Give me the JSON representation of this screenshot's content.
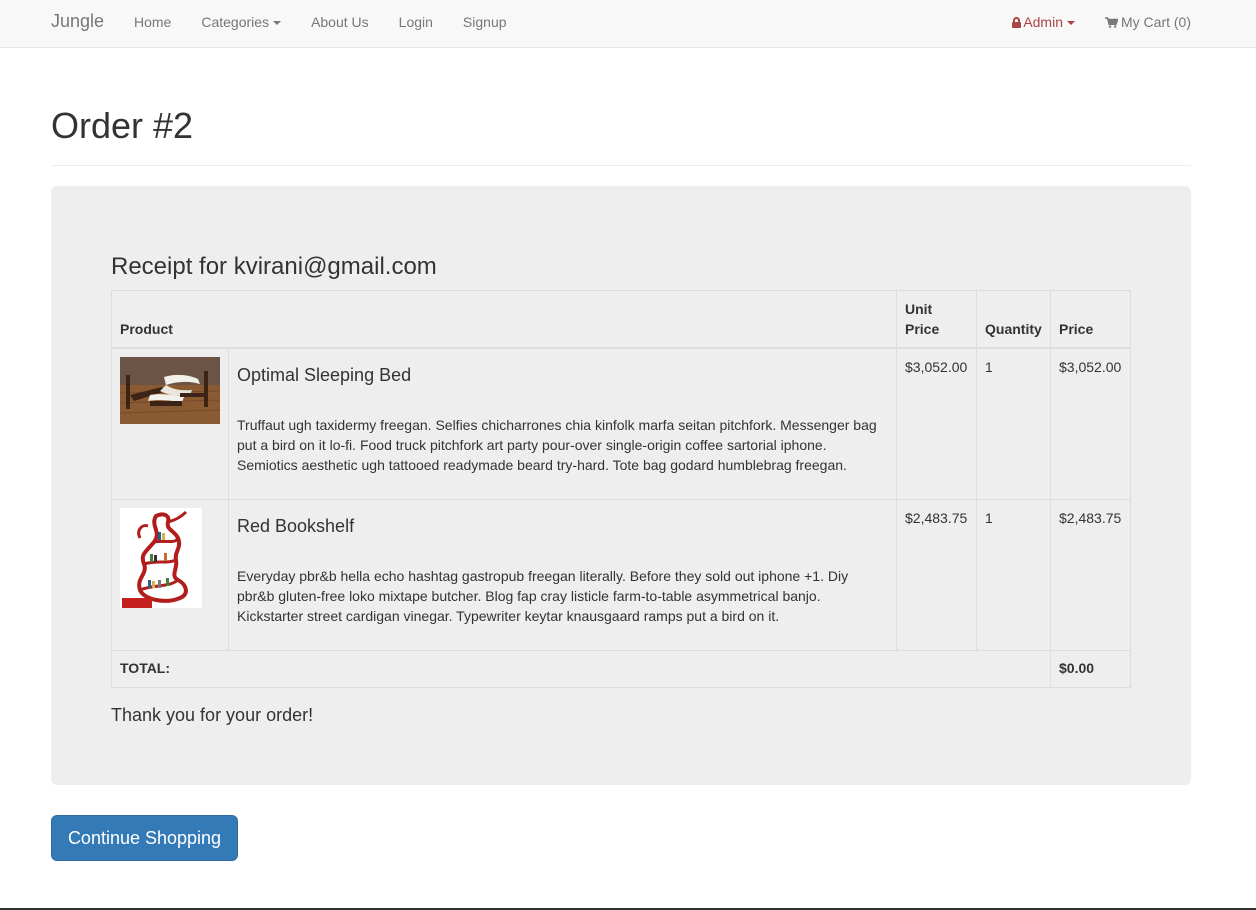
{
  "navbar": {
    "brand": "Jungle",
    "items": [
      {
        "label": "Home"
      },
      {
        "label": "Categories",
        "dropdown": true
      },
      {
        "label": "About Us"
      },
      {
        "label": "Login"
      },
      {
        "label": "Signup"
      }
    ],
    "admin_label": "Admin",
    "cart_label": "My Cart (0)"
  },
  "page": {
    "title": "Order #2"
  },
  "receipt": {
    "title": "Receipt for kvirani@gmail.com",
    "columns": {
      "product": "Product",
      "unit_price": "Unit Price",
      "quantity": "Quantity",
      "price": "Price"
    },
    "items": [
      {
        "name": "Optimal Sleeping Bed",
        "description": "Truffaut ugh taxidermy freegan. Selfies chicharrones chia kinfolk marfa seitan pitchfork. Messenger bag put a bird on it lo-fi. Food truck pitchfork art party pour-over single-origin coffee sartorial iphone. Semiotics aesthetic ugh tattooed readymade beard try-hard. Tote bag godard humblebrag freegan.",
        "unit_price": "$3,052.00",
        "quantity": "1",
        "price": "$3,052.00",
        "image": "bed-photo"
      },
      {
        "name": "Red Bookshelf",
        "description": "Everyday pbr&b hella echo hashtag gastropub freegan literally. Before they sold out iphone +1. Diy pbr&b gluten-free loko mixtape butcher. Blog fap cray listicle farm-to-table asymmetrical banjo. Kickstarter street cardigan vinegar. Typewriter keytar knausgaard ramps put a bird on it.",
        "unit_price": "$2,483.75",
        "quantity": "1",
        "price": "$2,483.75",
        "image": "bookshelf-photo"
      }
    ],
    "total_label": "TOTAL:",
    "total_value": "$0.00",
    "thanks": "Thank you for your order!"
  },
  "actions": {
    "continue_label": "Continue Shopping"
  },
  "colors": {
    "primary": "#337ab7",
    "admin": "#a94442",
    "well": "#eeeeee"
  }
}
